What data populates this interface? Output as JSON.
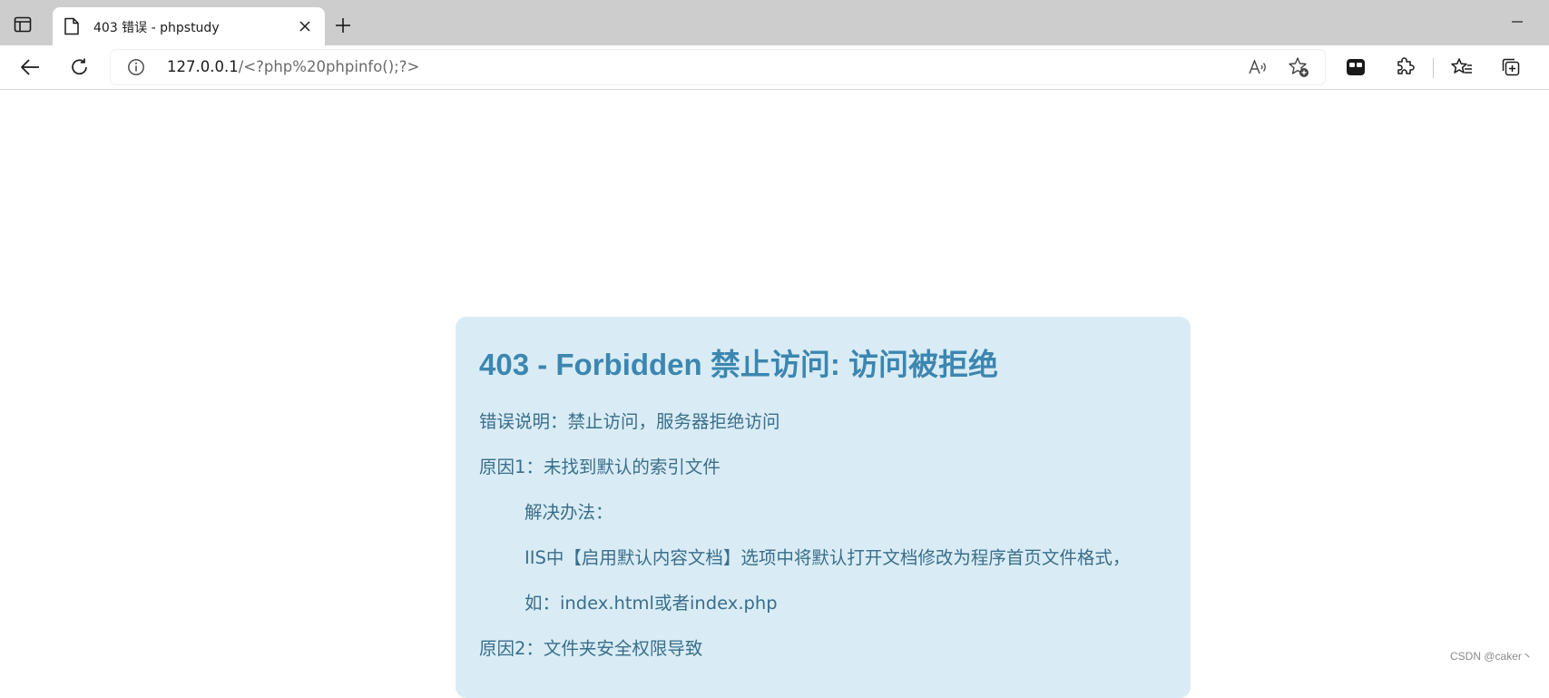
{
  "browser": {
    "tab": {
      "title": "403 错误 - phpstudy"
    },
    "address_bar": {
      "host": "127.0.0.1",
      "path": "/<?php%20phpinfo();?>"
    },
    "toolbar_icons": [
      "tab-actions-icon",
      "close-icon",
      "plus-icon",
      "minimize-icon",
      "back-arrow-icon",
      "refresh-icon",
      "info-icon",
      "read-aloud-icon",
      "add-favorite-icon",
      "profile-icon",
      "extensions-icon",
      "favorites-icon",
      "collections-icon"
    ]
  },
  "page": {
    "title": "403 - Forbidden 禁止访问: 访问被拒绝",
    "lines": [
      "错误说明：禁止访问，服务器拒绝访问",
      "原因1：未找到默认的索引文件",
      "解决办法：",
      "IIS中【启用默认内容文档】选项中将默认打开文档修改为程序首页文件格式，",
      "如：index.html或者index.php",
      "原因2：文件夹安全权限导致"
    ]
  },
  "watermark": "CSDN @caker丶",
  "colors": {
    "tabstrip": "#cdcdcd",
    "box_background": "#d9ecf5",
    "title_color": "#3c86b0",
    "text_color": "#3a6e8a"
  }
}
